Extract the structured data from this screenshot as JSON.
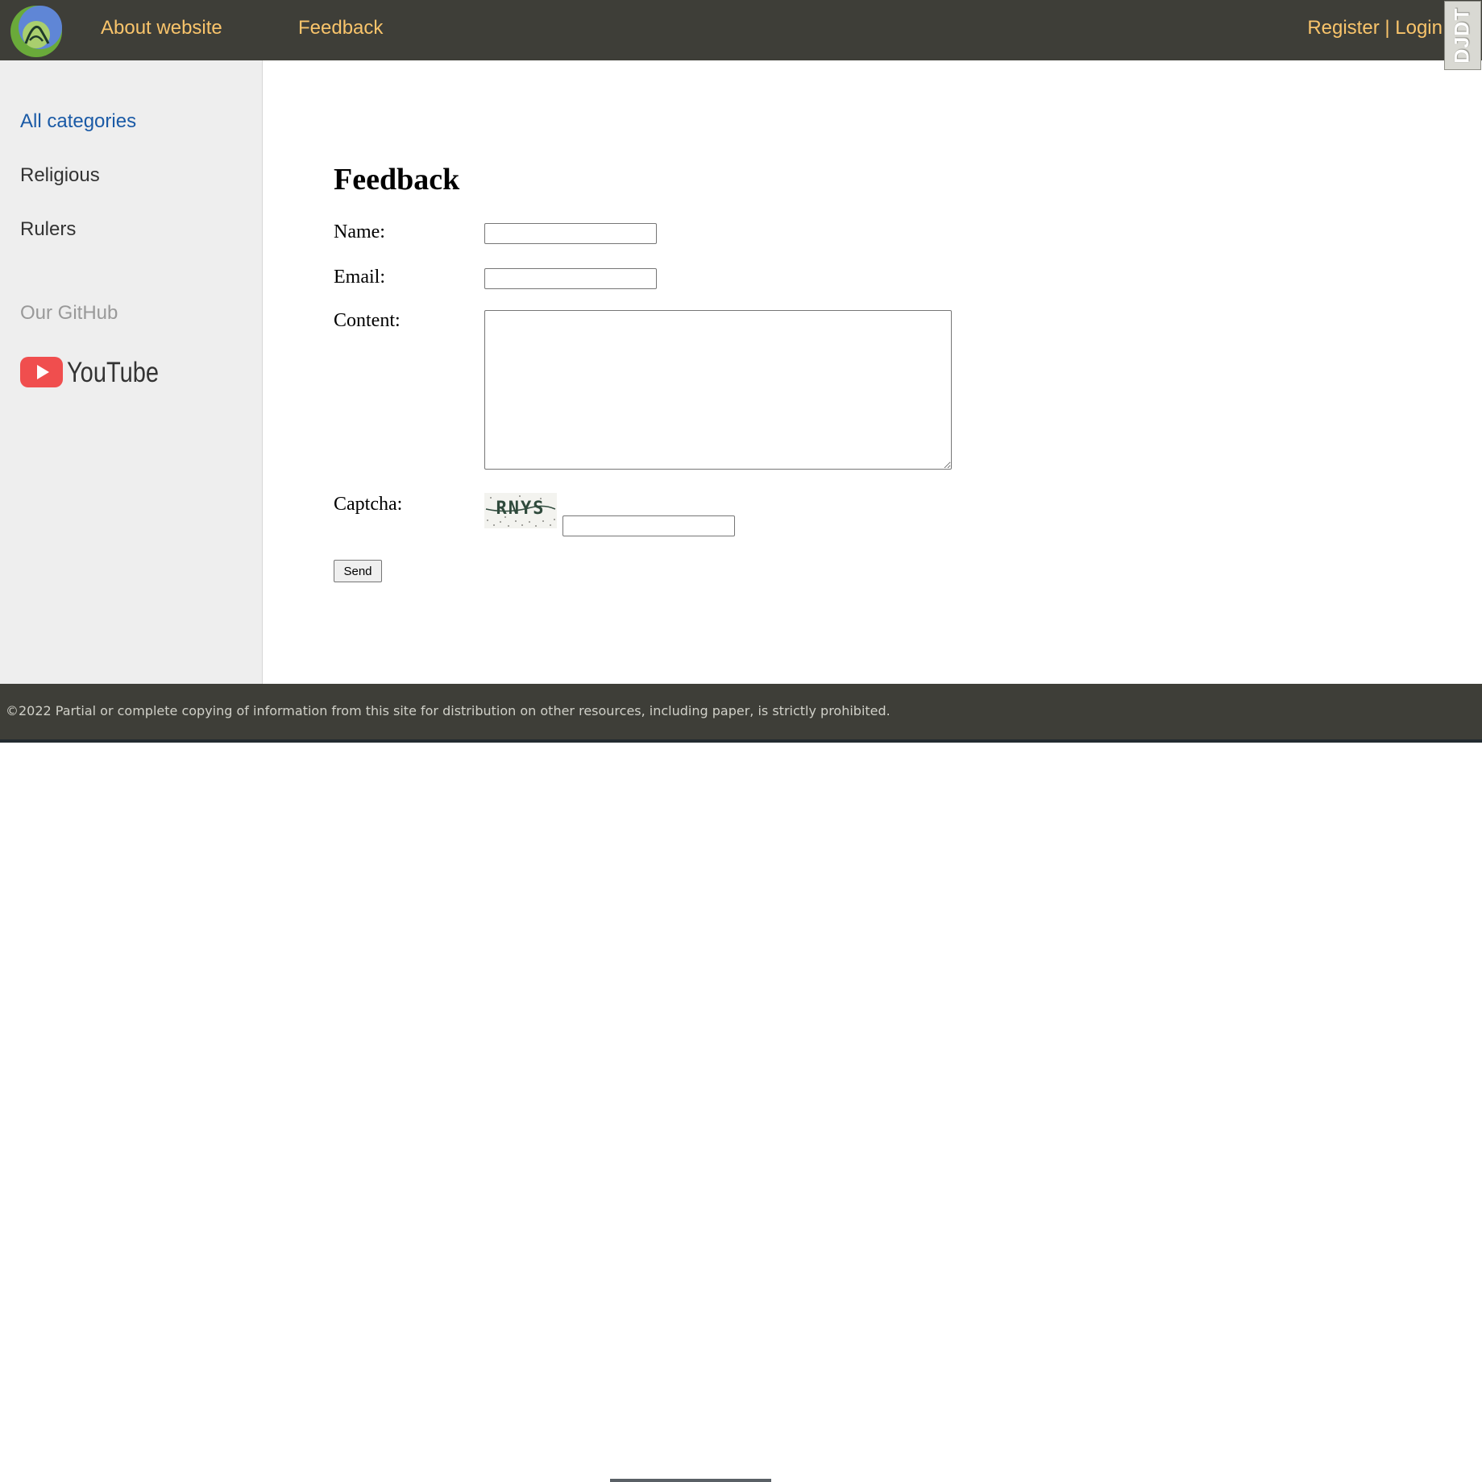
{
  "header": {
    "nav": [
      {
        "label": "About website"
      },
      {
        "label": "Feedback"
      }
    ],
    "auth": {
      "register": "Register",
      "separator": "|",
      "login": "Login"
    },
    "debug_toolbar": "DJDT",
    "colors": {
      "bar_bg": "#3e3e38",
      "link": "#f9c46b"
    }
  },
  "sidebar": {
    "all_categories": "All categories",
    "categories": [
      {
        "label": "Religious"
      },
      {
        "label": "Rulers"
      }
    ],
    "github": "Our GitHub",
    "youtube": "YouTube",
    "colors": {
      "bg": "#eeeeee",
      "active": "#1a5aa6"
    }
  },
  "form": {
    "title": "Feedback",
    "name_label": "Name:",
    "email_label": "Email:",
    "content_label": "Content:",
    "captcha_label": "Captcha:",
    "captcha_text": "RNYS",
    "submit": "Send"
  },
  "footer": {
    "text": "©2022 Partial or complete copying of information from this site for distribution on other resources, including paper, is strictly prohibited."
  }
}
